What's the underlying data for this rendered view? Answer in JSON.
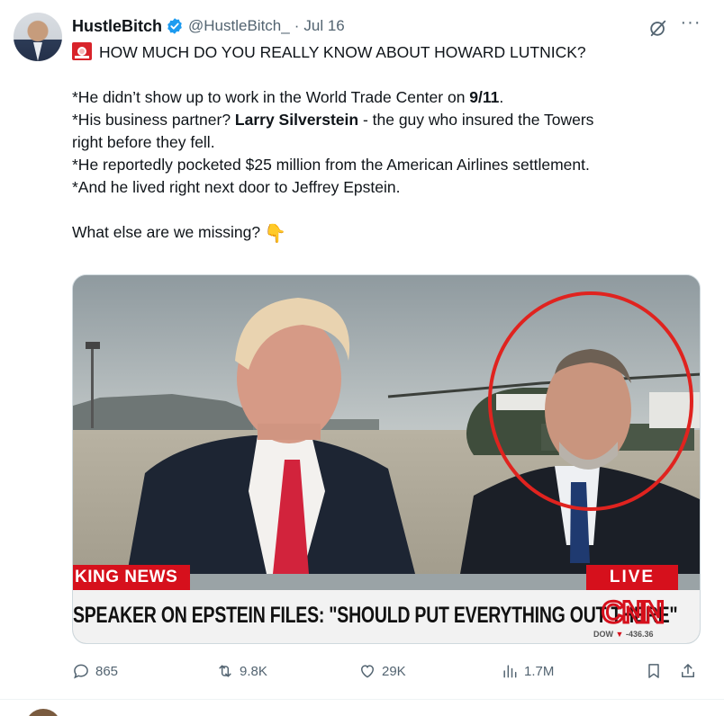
{
  "tweet": {
    "author": {
      "display_name": "HustleBitch",
      "handle": "@HustleBitch_",
      "verified": true,
      "avatar": "avatar"
    },
    "separator": "·",
    "date": "Jul 16",
    "icons": {
      "grok": "grok-icon",
      "more": "more-icon"
    },
    "text": {
      "title_emoji": "siren-emoji",
      "title": "HOW MUCH DO YOU REALLY KNOW ABOUT HOWARD LUTNICK?",
      "l1_pre": "*He didn’t show up to work in the World Trade Center on ",
      "l1_bold": "9/11",
      "l1_post": ".",
      "l2_pre": "*His business partner? ",
      "l2_bold": "Larry Silverstein",
      "l2_post": " - the guy who insured the Towers",
      "l3": "right before they fell.",
      "l4": "*He reportedly pocketed $25 million from the American Airlines settlement.",
      "l5": "*And he lived right next door to Jeffrey Epstein.",
      "l6": "What else are we missing?",
      "l6_emoji": "👇"
    },
    "media": {
      "breaking_label": "KING NEWS",
      "live_label": "LIVE",
      "headline": "SPEAKER ON EPSTEIN FILES: \"SHOULD PUT EVERYTHING OUT THERE\"",
      "network": "CNN",
      "dow_label": "DOW",
      "dow_arrow": "▼",
      "dow_value": "-436.36",
      "highlight_color": "#e0231f"
    },
    "actions": {
      "replies": "865",
      "reposts": "9.8K",
      "likes": "29K",
      "views": "1.7M"
    }
  },
  "colors": {
    "text": "#0f1419",
    "muted": "#536471",
    "verified": "#1d9bf0",
    "cnn_red": "#d6101c"
  }
}
